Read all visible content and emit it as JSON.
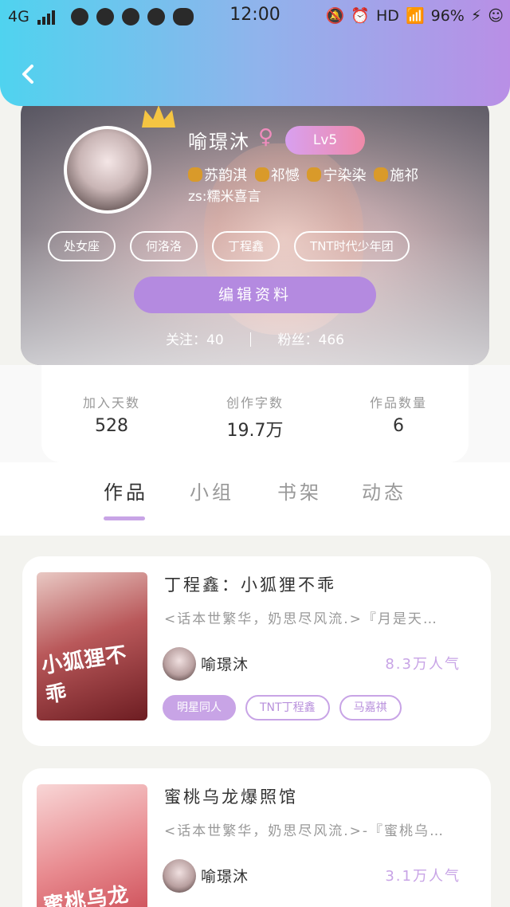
{
  "status_bar": {
    "network": "4G",
    "time": "12:00",
    "hd": "HD",
    "battery": "96%"
  },
  "profile": {
    "username": "喻璟沐",
    "gender_symbol": "♀",
    "level": "Lv5",
    "friends": [
      "苏韵淇",
      "祁憾",
      "宁染染",
      "施祁"
    ],
    "zs": "zs:糯米喜言",
    "tags": [
      "处女座",
      "何洛洛",
      "丁程鑫",
      "TNT时代少年团"
    ],
    "edit_label": "编辑资料",
    "following_label": "关注：40",
    "followers_label": "粉丝：466"
  },
  "stats": [
    {
      "label": "加入天数",
      "value": "528"
    },
    {
      "label": "创作字数",
      "value": "19.7万"
    },
    {
      "label": "作品数量",
      "value": "6"
    }
  ],
  "tabs": [
    "作品",
    "小组",
    "书架",
    "动态"
  ],
  "works": [
    {
      "title": "丁程鑫：小狐狸不乖",
      "description": "<话本世繁华，奶思尽风流.>『月是天…",
      "author": "喻璟沐",
      "popularity": "8.3万人气",
      "cover_text": "小狐狸不乖",
      "tags": [
        "明星同人",
        "TNT丁程鑫",
        "马嘉祺"
      ]
    },
    {
      "title": "蜜桃乌龙爆照馆",
      "description": "<话本世繁华，奶思尽风流.>-『蜜桃乌…",
      "author": "喻璟沐",
      "popularity": "3.1万人气",
      "cover_text": "蜜桃乌龙",
      "tags": []
    }
  ],
  "colors": {
    "accent": "#c8a4e6",
    "button": "#b48ae0",
    "header_start": "#4fd3ef",
    "header_end": "#b98fe6"
  }
}
